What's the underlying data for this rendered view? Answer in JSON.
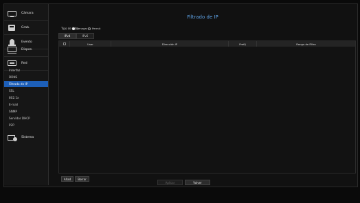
{
  "sidebar": {
    "main_items": [
      {
        "label": "Cámara",
        "icon": "camera-icon"
      },
      {
        "label": "Grab.",
        "icon": "record-icon"
      },
      {
        "label": "Evento",
        "icon": "event-icon"
      },
      {
        "label": "Dispos.",
        "icon": "device-icon"
      },
      {
        "label": "Red",
        "icon": "network-icon"
      }
    ],
    "sub_items": [
      {
        "label": "Interfaz"
      },
      {
        "label": "DDNS"
      },
      {
        "label": "Filtrado de IP"
      },
      {
        "label": "SSL"
      },
      {
        "label": "802.1x"
      },
      {
        "label": "E-mail"
      },
      {
        "label": "SNMP"
      },
      {
        "label": "Servidor DHCP"
      },
      {
        "label": "P2P"
      }
    ],
    "active_sub": "Filtrado de IP",
    "system": {
      "label": "Sistema",
      "icon": "system-icon"
    }
  },
  "page": {
    "title": "Filtrado de IP",
    "filter_type_label": "Tipo de filtro",
    "filter_options": [
      {
        "label": "Denegar",
        "selected": true
      },
      {
        "label": "Permit",
        "selected": false
      }
    ],
    "tabs": [
      {
        "label": "IPv4",
        "active": true
      },
      {
        "label": "IPv6",
        "active": false
      }
    ],
    "table": {
      "columns": [
        "Usar",
        "Dirección IP",
        "Prefij",
        "Rango de Filtro"
      ],
      "rows": []
    },
    "add_button": "Añad",
    "delete_button": "Borrar",
    "apply_button": "Aplicar",
    "back_button": "Volver"
  },
  "colors": {
    "accent": "#1d5fb8",
    "title": "#5fa4e8",
    "background": "#111111"
  }
}
